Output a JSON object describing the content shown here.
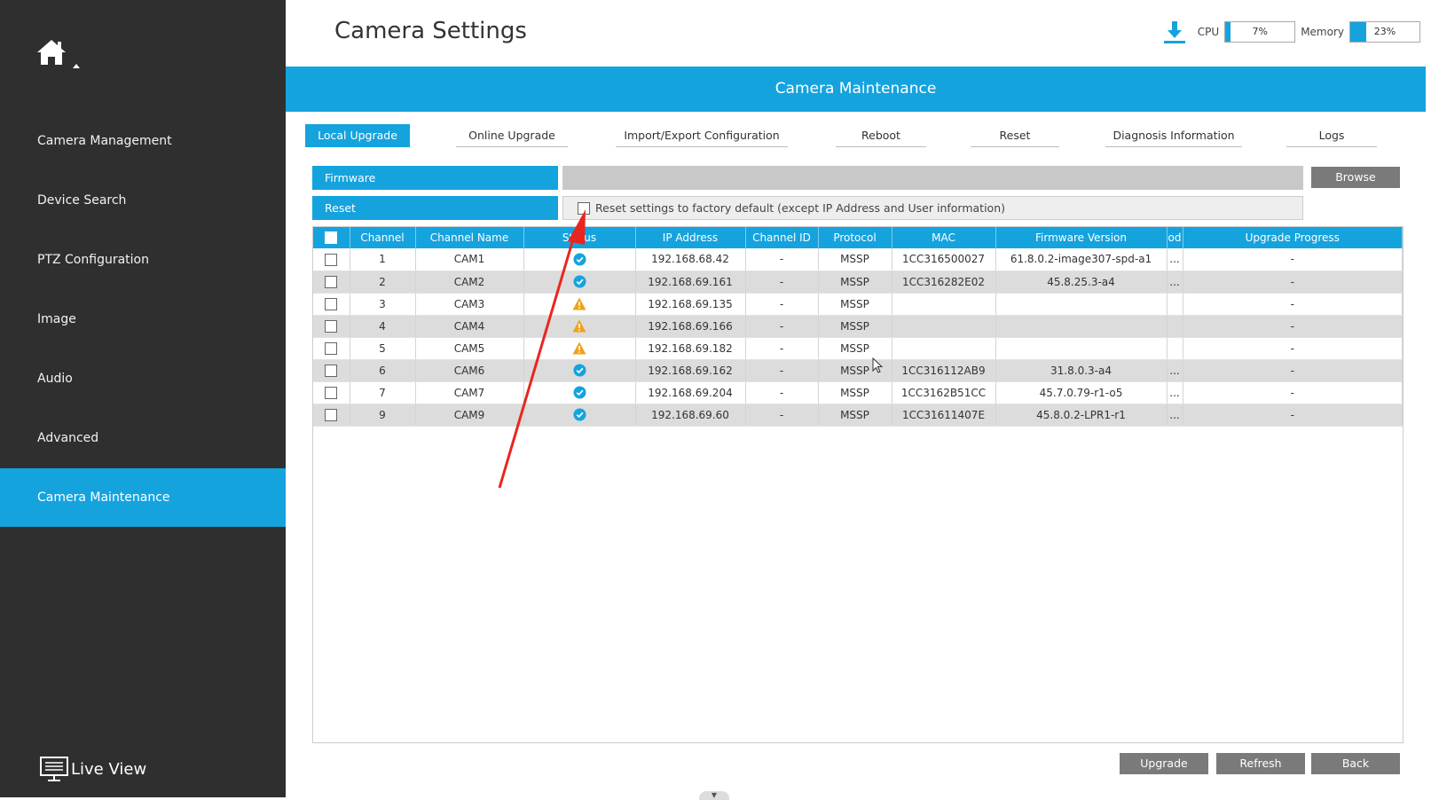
{
  "sidebar": {
    "items": [
      {
        "label": "Camera Management"
      },
      {
        "label": "Device Search"
      },
      {
        "label": "PTZ Configuration"
      },
      {
        "label": "Image"
      },
      {
        "label": "Audio"
      },
      {
        "label": "Advanced"
      },
      {
        "label": "Camera Maintenance",
        "active": true
      }
    ],
    "live_view": "Live View"
  },
  "header": {
    "title": "Camera Settings",
    "cpu_label": "CPU",
    "cpu_value": "7%",
    "cpu_fraction": 0.07,
    "memory_label": "Memory",
    "memory_value": "23%",
    "memory_fraction": 0.23
  },
  "banner": "Camera Maintenance",
  "tabs": [
    "Local Upgrade",
    "Online Upgrade",
    "Import/Export Configuration",
    "Reboot",
    "Reset",
    "Diagnosis Information",
    "Logs"
  ],
  "firmware": {
    "label": "Firmware",
    "browse": "Browse"
  },
  "reset": {
    "label": "Reset",
    "option": "Reset settings to factory default (except IP Address and User information)"
  },
  "table": {
    "columns": [
      "Channel",
      "Channel Name",
      "Status",
      "IP Address",
      "Channel ID",
      "Protocol",
      "MAC",
      "Firmware Version",
      "od",
      "Upgrade Progress"
    ],
    "rows": [
      {
        "channel": "1",
        "name": "CAM1",
        "status": "online",
        "ip": "192.168.68.42",
        "channel_id": "-",
        "protocol": "MSSP",
        "mac": "1CC316500027",
        "firmware": "61.8.0.2-image307-spd-a1",
        "od": "...",
        "progress": "-"
      },
      {
        "channel": "2",
        "name": "CAM2",
        "status": "online",
        "ip": "192.168.69.161",
        "channel_id": "-",
        "protocol": "MSSP",
        "mac": "1CC316282E02",
        "firmware": "45.8.25.3-a4",
        "od": "...",
        "progress": "-"
      },
      {
        "channel": "3",
        "name": "CAM3",
        "status": "warning",
        "ip": "192.168.69.135",
        "channel_id": "-",
        "protocol": "MSSP",
        "mac": "",
        "firmware": "",
        "od": "",
        "progress": "-"
      },
      {
        "channel": "4",
        "name": "CAM4",
        "status": "warning",
        "ip": "192.168.69.166",
        "channel_id": "-",
        "protocol": "MSSP",
        "mac": "",
        "firmware": "",
        "od": "",
        "progress": "-"
      },
      {
        "channel": "5",
        "name": "CAM5",
        "status": "warning",
        "ip": "192.168.69.182",
        "channel_id": "-",
        "protocol": "MSSP",
        "mac": "",
        "firmware": "",
        "od": "",
        "progress": "-"
      },
      {
        "channel": "6",
        "name": "CAM6",
        "status": "online",
        "ip": "192.168.69.162",
        "channel_id": "-",
        "protocol": "MSSP",
        "mac": "1CC316112AB9",
        "firmware": "31.8.0.3-a4",
        "od": "...",
        "progress": "-"
      },
      {
        "channel": "7",
        "name": "CAM7",
        "status": "online",
        "ip": "192.168.69.204",
        "channel_id": "-",
        "protocol": "MSSP",
        "mac": "1CC3162B51CC",
        "firmware": "45.7.0.79-r1-o5",
        "od": "...",
        "progress": "-"
      },
      {
        "channel": "9",
        "name": "CAM9",
        "status": "online",
        "ip": "192.168.69.60",
        "channel_id": "-",
        "protocol": "MSSP",
        "mac": "1CC31611407E",
        "firmware": "45.8.0.2-LPR1-r1",
        "od": "...",
        "progress": "-"
      }
    ]
  },
  "buttons": {
    "upgrade": "Upgrade",
    "refresh": "Refresh",
    "back": "Back"
  },
  "colors": {
    "accent": "#15a3de",
    "sidebar": "#2f2f2f",
    "warning": "#f0a21a",
    "annotation": "#e8261f"
  }
}
